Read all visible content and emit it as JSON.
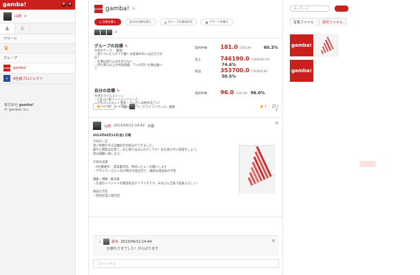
{
  "sidebar": {
    "logo": "gamba!",
    "user": {
      "name": "山田"
    },
    "award_header": "アワード",
    "group_header": "グループ",
    "groups": [
      {
        "label": "gamba!",
        "icon_text": "gamba!"
      },
      {
        "label": "A社様プロジェクト",
        "icon_text": "A"
      }
    ],
    "add_symbol": "+",
    "footer": {
      "company": "株式会社",
      "company_brand": "gamba!",
      "copyright": "© gamba! inc."
    }
  },
  "main": {
    "header": {
      "title": "gamba!",
      "logo_text": "gamba!"
    },
    "buttons": [
      {
        "label": "日報を書く",
        "style": "red"
      },
      {
        "label": "自分の日報を読む",
        "style": "plain"
      },
      {
        "label": "グループの達成状況",
        "style": "plain"
      },
      {
        "label": "アワードを贈る",
        "style": "plain"
      }
    ],
    "member_add": "+",
    "group_goals": {
      "title": "グループの目標",
      "body": [
        "今月のテーマ： 最速！",
        "・思いついたらすぐ行動！お客様の声には全力で対応！",
        "・仕事は割り込みを許さない",
        "・持ち寄る以上の付加価値、ワメの可い仕事は磨いて"
      ],
      "rows": [
        {
          "label": "契約件数",
          "value": "181.0",
          "denom": "/300.0件",
          "pct": "60.3%"
        },
        {
          "label": "売上",
          "value": "746190.0",
          "denom": "/1000000.0円",
          "pct": "74.6%"
        },
        {
          "label": "利益",
          "value": "353700.0",
          "denom": "/700000.0円",
          "pct": "50.5%"
        }
      ]
    },
    "my_goals": {
      "title": "自分の目標",
      "body": [
        "今月のマイルストーン",
        "・1当(火) 新バージョンリリース",
        "・2当(土) イベント発表・プレゼンは絶ゆ次ごに！",
        "・5当(水) セミナー「gambaでワークライフバランス」講演"
      ],
      "rows": [
        {
          "label": "契約件数",
          "value": "96.0",
          "denom": "/100.0件",
          "pct": "96.0%"
        }
      ]
    },
    "post": {
      "author": "山田",
      "date": "2013/04/12-14:42",
      "tag": "日報",
      "heading": "2013年04月12日(金) 日報",
      "body": [
        "今日の一言",
        "週い時間を作る自働化の仕組みができました。",
        "最今と開発は出来て、あと残りはほんの少しです！気を抜かずに前進をしよう。",
        "昇は報酬に値します。",
        "",
        "今日の成果",
        "・A社撤維作： 提案書完成、明日レビューお願いします",
        "・デザイナーさんへのLP制作の発注完了、継続は来週末の予定",
        "",
        "課題・問題・解決策",
        "・先週のイベントへの集客状況がイマイチです、みなさん全員で拡散よろしく！",
        "",
        "明日の予定",
        "・明日担当に報告回"
      ],
      "like_label": "いいね!",
      "like_by": "+宮松",
      "like_count": "2",
      "comment_count": "1",
      "close": "×"
    },
    "reply": {
      "author": "鈴木",
      "date": "2013/04/12-14:44",
      "body": "お疲れさまでした！がんばります",
      "close": "×"
    },
    "comment_placeholder": "コメントする"
  },
  "right": {
    "search_placeholder": "キーワード",
    "tabs": [
      "写真ファイル",
      "添付ファイル"
    ],
    "thumb_text": "gamba!"
  }
}
